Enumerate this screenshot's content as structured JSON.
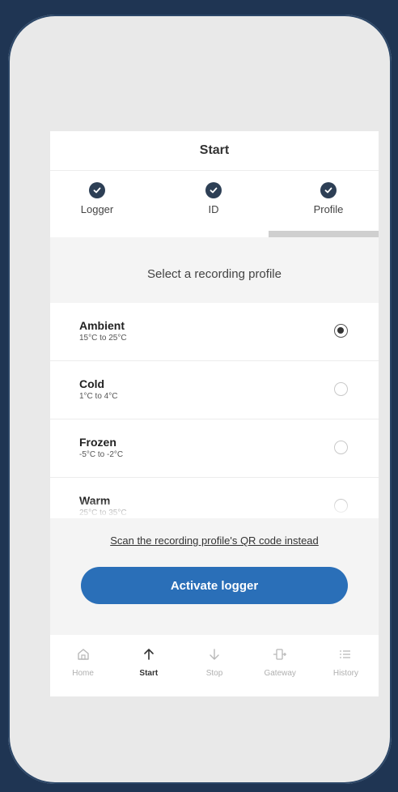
{
  "header": {
    "title": "Start"
  },
  "stepper": {
    "steps": [
      {
        "label": "Logger",
        "icon": "check-icon"
      },
      {
        "label": "ID",
        "icon": "check-icon"
      },
      {
        "label": "Profile",
        "icon": "check-icon"
      }
    ],
    "active_step": "Profile"
  },
  "prompt": "Select a recording profile",
  "profiles": [
    {
      "name": "Ambient",
      "range": "15°C to 25°C",
      "selected": true
    },
    {
      "name": "Cold",
      "range": "1°C to 4°C",
      "selected": false
    },
    {
      "name": "Frozen",
      "range": "-5°C to -2°C",
      "selected": false
    },
    {
      "name": "Warm",
      "range": "25°C to 35°C",
      "selected": false
    }
  ],
  "scan_link": "Scan the recording profile's QR code instead",
  "activate_button": "Activate logger",
  "bottom_nav": [
    {
      "label": "Home",
      "icon": "home-icon"
    },
    {
      "label": "Start",
      "icon": "arrow-up-icon",
      "active": true
    },
    {
      "label": "Stop",
      "icon": "arrow-down-icon"
    },
    {
      "label": "Gateway",
      "icon": "gateway-icon"
    },
    {
      "label": "History",
      "icon": "list-icon"
    }
  ],
  "colors": {
    "accent": "#2a6fb8",
    "step_check": "#2d3f55",
    "background": "#1f3553"
  }
}
